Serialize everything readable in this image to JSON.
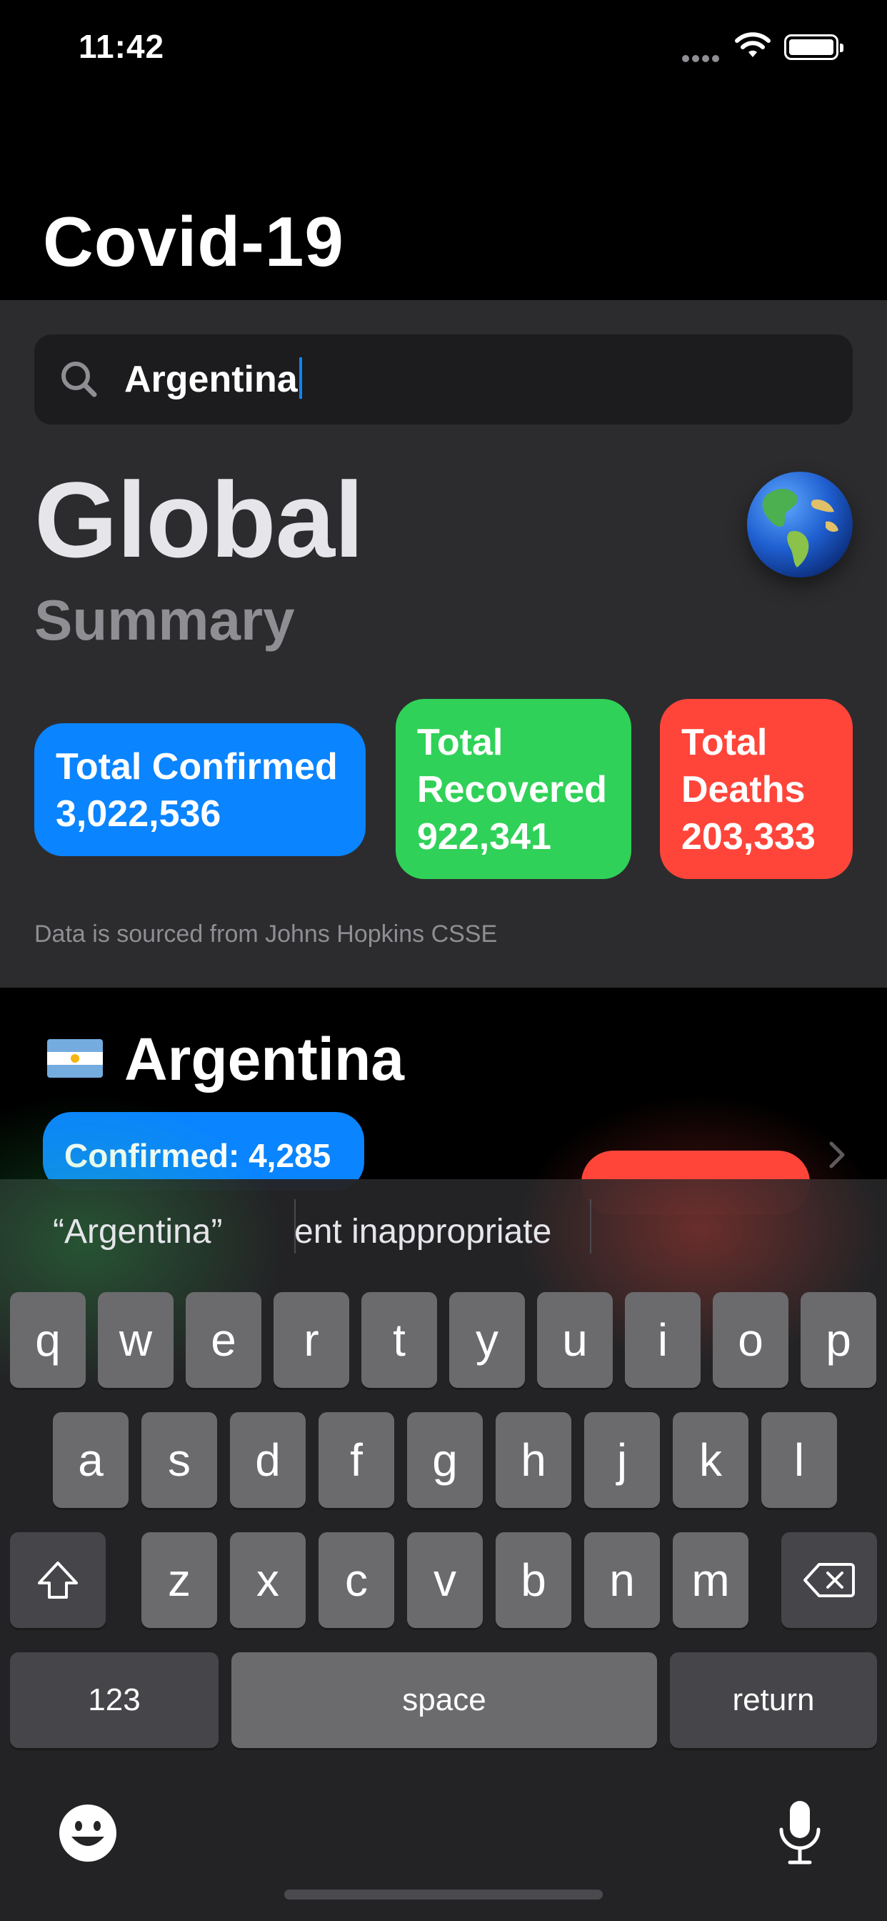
{
  "status_bar": {
    "time": "11:42"
  },
  "nav": {
    "title": "Covid-19"
  },
  "search": {
    "value": "Argentina"
  },
  "global": {
    "title": "Global",
    "subtitle": "Summary",
    "confirmed_label": "Total Confirmed",
    "confirmed_value": "3,022,536",
    "recovered_label_line1": "Total",
    "recovered_label_line2": "Recovered",
    "recovered_value": "922,341",
    "deaths_label_line1": "Total",
    "deaths_label_line2": "Deaths",
    "deaths_value": "203,333",
    "source_note": "Data is sourced from Johns Hopkins CSSE"
  },
  "country": {
    "name": "Argentina",
    "confirmed_text": "Confirmed: 4,285"
  },
  "keyboard": {
    "suggestions": [
      "“Argentina”",
      "ent inappropriate"
    ],
    "row1": [
      "q",
      "w",
      "e",
      "r",
      "t",
      "y",
      "u",
      "i",
      "o",
      "p"
    ],
    "row2": [
      "a",
      "s",
      "d",
      "f",
      "g",
      "h",
      "j",
      "k",
      "l"
    ],
    "row3": [
      "z",
      "x",
      "c",
      "v",
      "b",
      "n",
      "m"
    ],
    "numbers_label": "123",
    "space_label": "space",
    "return_label": "return"
  },
  "colors": {
    "accent_blue": "#0a84ff",
    "recovered_green": "#30d158",
    "deaths_red": "#ff453a"
  },
  "icons": [
    "search-icon",
    "globe-icon",
    "wifi-icon",
    "battery-icon",
    "chevron-right-icon",
    "shift-icon",
    "delete-icon",
    "emoji-icon",
    "microphone-icon"
  ]
}
